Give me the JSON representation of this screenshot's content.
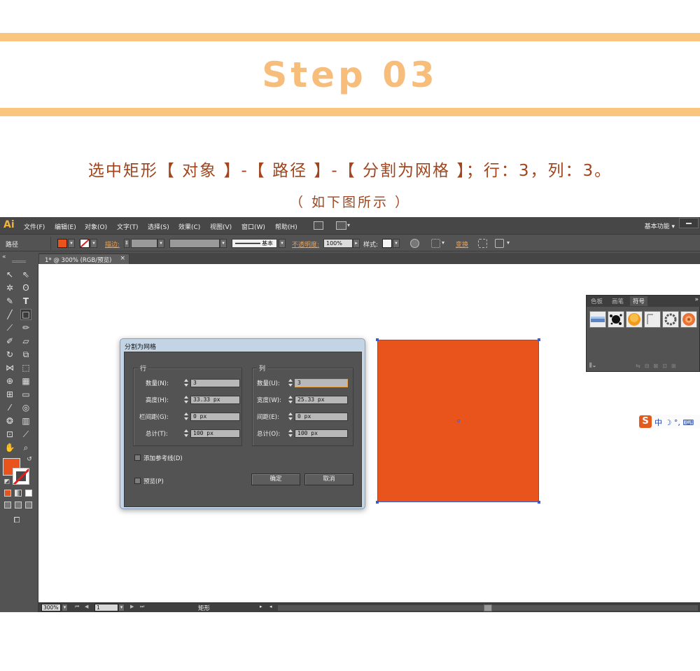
{
  "banner": {
    "step_title": "Step 03",
    "instruction": "选中矩形【 对象 】-【 路径 】-【 分割为网格 】；行：3，列：3。",
    "caption": "（ 如下图所示 ）"
  },
  "app": {
    "logo": "Ai",
    "menu": [
      "文件(F)",
      "编辑(E)",
      "对象(O)",
      "文字(T)",
      "选择(S)",
      "效果(C)",
      "视图(V)",
      "窗口(W)",
      "帮助(H)"
    ],
    "workspace": "基本功能",
    "control_bar": {
      "object_type": "路径",
      "stroke_label": "描边:",
      "stroke_style": "基本",
      "opacity_label": "不透明度:",
      "opacity_value": "100%",
      "style_label": "样式:",
      "transform_label": "变换",
      "fill_color": "#e8541b"
    },
    "document_tab": {
      "label": "1* @ 300% (RGB/预览)",
      "close": "×"
    },
    "symbols_panel": {
      "tabs": [
        "色板",
        "画笔",
        "符号"
      ],
      "active_tab": "符号",
      "more": "»",
      "footer_icon": "symbol-library-menu-icon"
    },
    "ime": {
      "logo": "S",
      "text": "中 ☽ °, ⌨"
    },
    "status_bar": {
      "zoom": "300%",
      "artboard": "1",
      "selection": "矩形"
    }
  },
  "dialog": {
    "title": "分割为网格",
    "rows": {
      "title": "行",
      "count_label": "数量(N):",
      "count_value": "3",
      "height_label": "高度(H):",
      "height_value": "33.33 px",
      "gutter_label": "栏间距(G):",
      "gutter_value": "0 px",
      "total_label": "总计(T):",
      "total_value": "100 px"
    },
    "columns": {
      "title": "列",
      "count_label": "数量(U):",
      "count_value": "3",
      "width_label": "宽度(W):",
      "width_value": "25.33 px",
      "gutter_label": "间距(E):",
      "gutter_value": "0 px",
      "total_label": "总计(O):",
      "total_value": "100 px"
    },
    "add_guides_label": "添加参考线(D)",
    "preview_label": "预览(P)",
    "ok_label": "确定",
    "cancel_label": "取消"
  }
}
